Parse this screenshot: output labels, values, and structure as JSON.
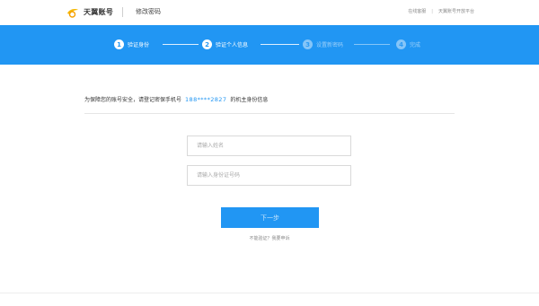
{
  "header": {
    "brand": "天翼账号",
    "page_title": "修改密码",
    "links": [
      "在线客服",
      "天翼账号开放平台"
    ],
    "separator": "|"
  },
  "steps": [
    {
      "number": "1",
      "label": "验证身份",
      "state": "done"
    },
    {
      "number": "2",
      "label": "验证个人信息",
      "state": "current"
    },
    {
      "number": "3",
      "label": "设置新密码",
      "state": "pending"
    },
    {
      "number": "4",
      "label": "完成",
      "state": "pending"
    }
  ],
  "notice": {
    "prefix": "为保障您的账号安全，请登记密保手机号",
    "phone": "188****2827",
    "suffix": "的机主身份信息"
  },
  "form": {
    "name_placeholder": "请输入姓名",
    "name_value": "",
    "id_placeholder": "请输入身份证号码",
    "id_value": "",
    "next_label": "下一步",
    "alt_link": "不能验证？我要申诉"
  },
  "colors": {
    "accent": "#2196f3",
    "brand_yellow": "#f5b800"
  }
}
